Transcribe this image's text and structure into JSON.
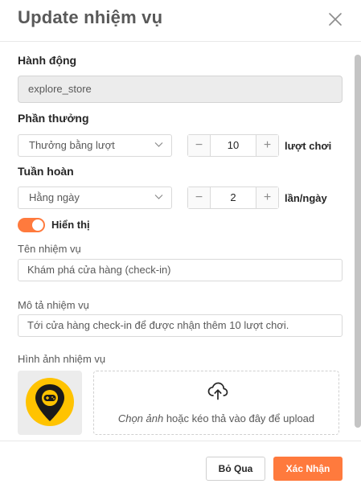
{
  "modal": {
    "title": "Update nhiệm vụ"
  },
  "form": {
    "action": {
      "label": "Hành động",
      "value": "explore_store"
    },
    "reward": {
      "label": "Phần thưởng",
      "select_value": "Thưởng bằng lượt",
      "stepper_value": "10",
      "unit": "lượt chơi"
    },
    "recurrence": {
      "label": "Tuần hoàn",
      "select_value": "Hằng ngày",
      "stepper_value": "2",
      "unit": "lần/ngày"
    },
    "visibility": {
      "label": "Hiển thị",
      "enabled": true
    },
    "task_name": {
      "label": "Tên nhiệm vụ",
      "value": "Khám phá cửa hàng (check-in)"
    },
    "task_description": {
      "label": "Mô tả nhiệm vụ",
      "value": "Tới cửa hàng check-in để được nhận thêm 10 lượt chơi."
    },
    "task_image": {
      "label": "Hình ảnh nhiệm vụ",
      "thumbnail_icon": "gamepad-location-pin-icon",
      "upload_prefix": "Chọn ảnh",
      "upload_suffix": " hoặc kéo thả vào đây để upload",
      "upload_icon": "cloud-upload-icon"
    }
  },
  "footer": {
    "cancel_label": "Bỏ Qua",
    "confirm_label": "Xác Nhận"
  },
  "colors": {
    "accent": "#ff7a3d",
    "title": "#595959",
    "thumbnail_badge": "#ffc300"
  },
  "icons": {
    "close": "close-icon",
    "chevron": "chevron-down-icon",
    "minus": "minus-icon",
    "plus": "plus-icon"
  }
}
